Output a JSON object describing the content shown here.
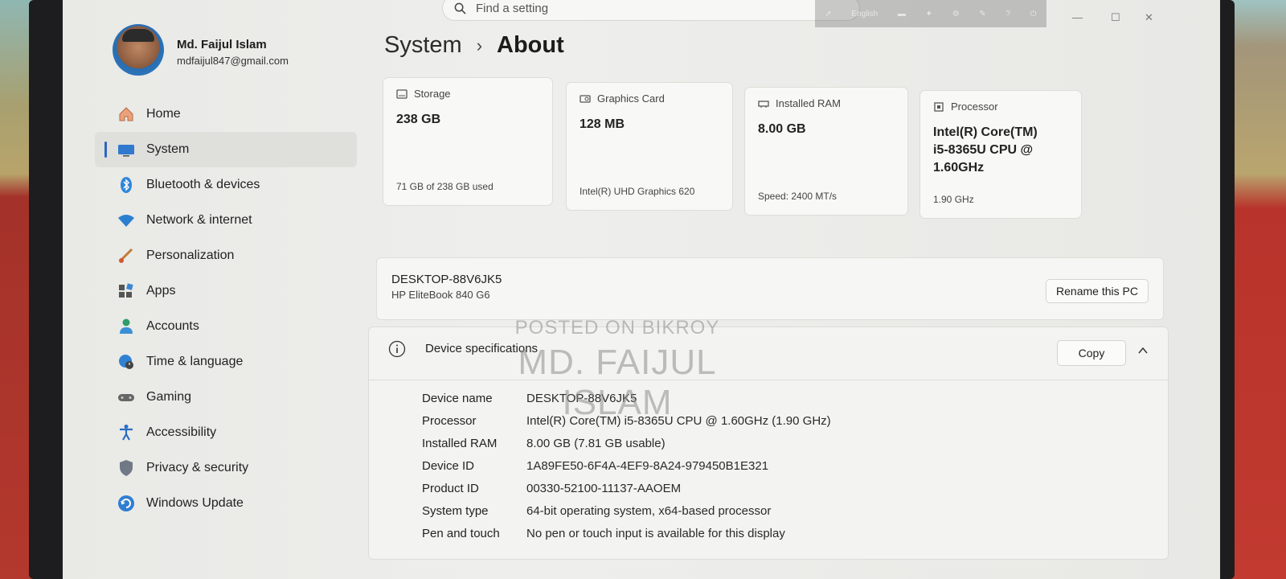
{
  "search": {
    "placeholder": "Find a setting"
  },
  "overlay_toolbar": {
    "lang": "English"
  },
  "profile": {
    "name": "Md. Faijul Islam",
    "email": "mdfaijul847@gmail.com"
  },
  "sidebar": {
    "items": [
      {
        "label": "Home",
        "icon": "home-icon"
      },
      {
        "label": "System",
        "icon": "monitor-icon",
        "active": true
      },
      {
        "label": "Bluetooth & devices",
        "icon": "bluetooth-icon"
      },
      {
        "label": "Network & internet",
        "icon": "wifi-icon"
      },
      {
        "label": "Personalization",
        "icon": "brush-icon"
      },
      {
        "label": "Apps",
        "icon": "apps-icon"
      },
      {
        "label": "Accounts",
        "icon": "person-icon"
      },
      {
        "label": "Time & language",
        "icon": "globe-clock-icon"
      },
      {
        "label": "Gaming",
        "icon": "gamepad-icon"
      },
      {
        "label": "Accessibility",
        "icon": "accessibility-icon"
      },
      {
        "label": "Privacy & security",
        "icon": "shield-icon"
      },
      {
        "label": "Windows Update",
        "icon": "refresh-icon"
      }
    ]
  },
  "breadcrumb": {
    "parent": "System",
    "separator": "›",
    "current": "About"
  },
  "cards": [
    {
      "label": "Storage",
      "value": "238 GB",
      "sub": "71 GB of 238 GB used"
    },
    {
      "label": "Graphics Card",
      "value": "128 MB",
      "sub": "Intel(R) UHD Graphics 620"
    },
    {
      "label": "Installed RAM",
      "value": "8.00 GB",
      "sub": "Speed: 2400 MT/s"
    },
    {
      "label": "Processor",
      "value": "Intel(R) Core(TM) i5-8365U CPU @ 1.60GHz",
      "sub": "1.90 GHz"
    }
  ],
  "pc": {
    "name": "DESKTOP-88V6JK5",
    "model": "HP EliteBook 840 G6",
    "rename_label": "Rename this PC"
  },
  "specs": {
    "title": "Device specifications",
    "copy_label": "Copy",
    "rows": [
      {
        "key": "Device name",
        "value": "DESKTOP-88V6JK5"
      },
      {
        "key": "Processor",
        "value": "Intel(R) Core(TM) i5-8365U CPU @ 1.60GHz (1.90 GHz)"
      },
      {
        "key": "Installed RAM",
        "value": "8.00 GB (7.81 GB usable)"
      },
      {
        "key": "Device ID",
        "value": "1A89FE50-6F4A-4EF9-8A24-979450B1E321"
      },
      {
        "key": "Product ID",
        "value": "00330-52100-11137-AAOEM"
      },
      {
        "key": "System type",
        "value": "64-bit operating system, x64-based processor"
      },
      {
        "key": "Pen and touch",
        "value": "No pen or touch input is available for this display"
      }
    ]
  },
  "watermark": {
    "line1": "POSTED ON BIKROY",
    "line2": "MD. FAIJUL ISLAM"
  },
  "colors": {
    "accent": "#2b66c2",
    "background": "#ecece9"
  }
}
